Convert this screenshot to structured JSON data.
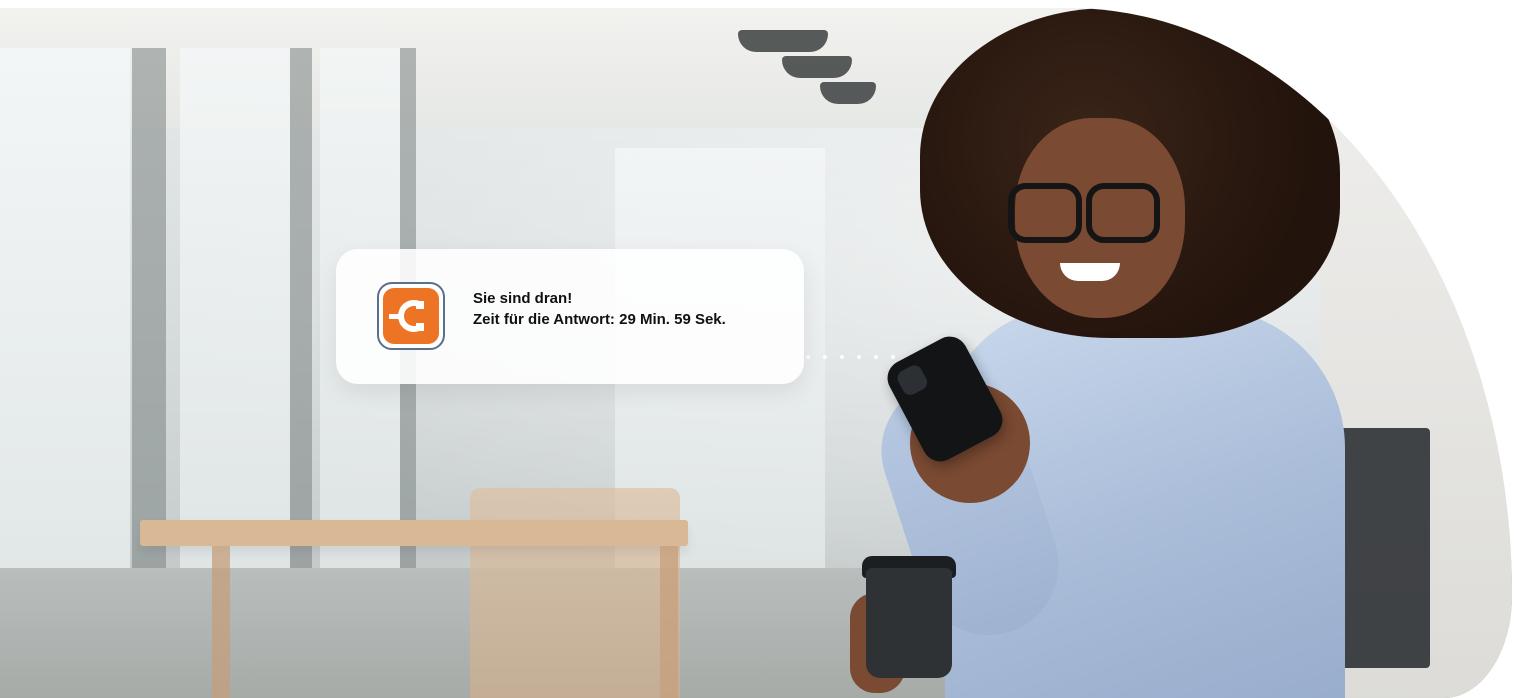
{
  "notification": {
    "app_icon": "orange-c-logo-icon",
    "title": "Sie sind dran!",
    "body": "Zeit für die Antwort: 29 Min. 59 Sek."
  },
  "photo": {
    "subject": "woman-with-smartphone-and-coffee-cup"
  },
  "colors": {
    "brand_orange": "#ec7424",
    "icon_border": "#5c6f8a",
    "card_background": "#ffffff",
    "text": "#111111"
  }
}
